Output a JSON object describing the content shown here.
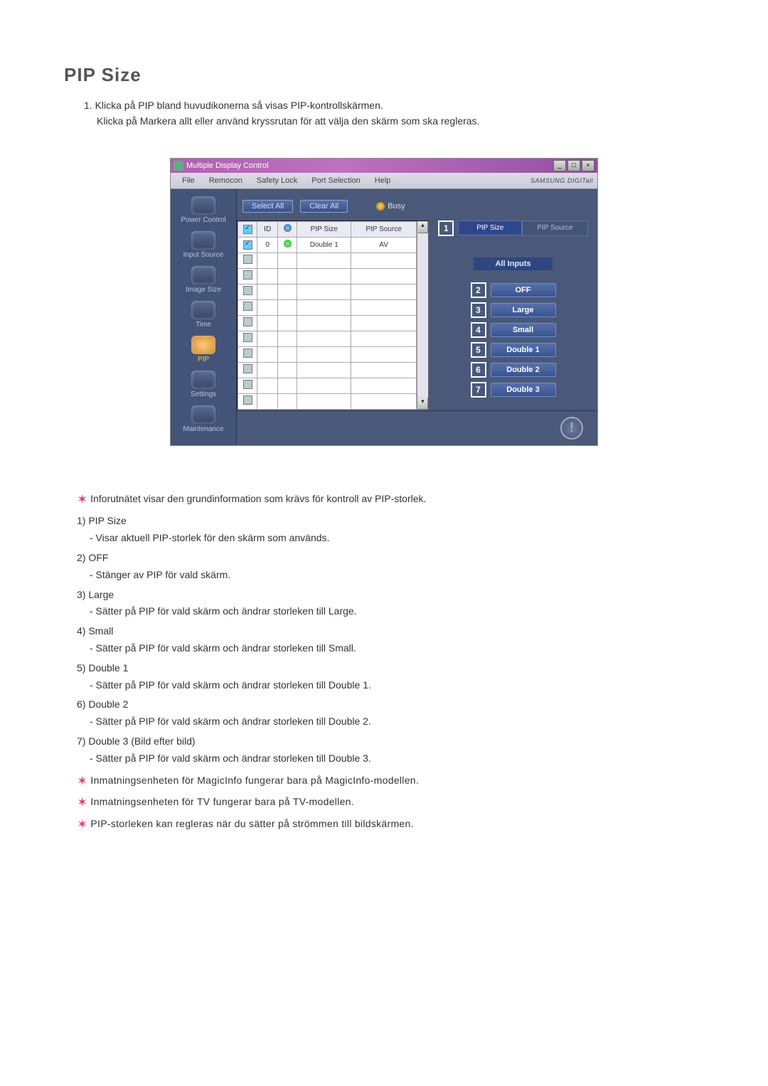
{
  "title": "PIP Size",
  "intro": {
    "line1": "1. Klicka på PIP bland huvudikonerna så visas PIP-kontrollskärmen.",
    "line2": "Klicka på Markera allt eller använd kryssrutan för att välja den skärm som ska regleras."
  },
  "app": {
    "window_title": "Multiple Display Control",
    "menus": [
      "File",
      "Remocon",
      "Safety Lock",
      "Port Selection",
      "Help"
    ],
    "brand": "SAMSUNG DIGITall",
    "sidebar": [
      {
        "label": "Power Control",
        "active": false
      },
      {
        "label": "Input Source",
        "active": false
      },
      {
        "label": "Image Size",
        "active": false
      },
      {
        "label": "Time",
        "active": false
      },
      {
        "label": "PIP",
        "active": true
      },
      {
        "label": "Settings",
        "active": false
      },
      {
        "label": "Maintenance",
        "active": false
      }
    ],
    "select_all": "Select All",
    "clear_all": "Clear All",
    "busy": "Busy",
    "table": {
      "headers": [
        "",
        "ID",
        "",
        "PIP Size",
        "PIP Source"
      ],
      "rows": [
        {
          "checked": true,
          "id": "0",
          "status": "green",
          "size": "Double 1",
          "source": "AV"
        }
      ]
    },
    "tabs": {
      "size": "PIP Size",
      "source": "PIP Source"
    },
    "all_inputs": "All Inputs",
    "options": [
      "OFF",
      "Large",
      "Small",
      "Double 1",
      "Double 2",
      "Double 3"
    ]
  },
  "notes": {
    "intro": "Inforutnätet visar den grundinformation som krävs för kontroll av PIP-storlek.",
    "items": [
      {
        "h": "1) PIP Size",
        "d": "- Visar aktuell PIP-storlek för den skärm som används."
      },
      {
        "h": "2) OFF",
        "d": "- Stänger av PIP för vald skärm."
      },
      {
        "h": "3) Large",
        "d": "- Sätter på PIP för vald skärm och ändrar storleken till Large."
      },
      {
        "h": "4) Small",
        "d": "- Sätter på PIP för vald skärm och ändrar storleken till Small."
      },
      {
        "h": "5) Double 1",
        "d": "- Sätter på PIP för vald skärm och ändrar storleken till Double 1."
      },
      {
        "h": "6) Double 2",
        "d": "- Sätter på PIP för vald skärm och ändrar storleken till Double 2."
      },
      {
        "h": "7) Double 3 (Bild efter bild)",
        "d": "- Sätter på PIP för vald skärm och ändrar storleken till Double 3."
      }
    ],
    "final": [
      "Inmatningsenheten för MagicInfo fungerar bara på MagicInfo-modellen.",
      "Inmatningsenheten för TV fungerar bara på TV-modellen.",
      "PIP-storleken kan regleras när du sätter på strömmen till bildskärmen."
    ]
  }
}
